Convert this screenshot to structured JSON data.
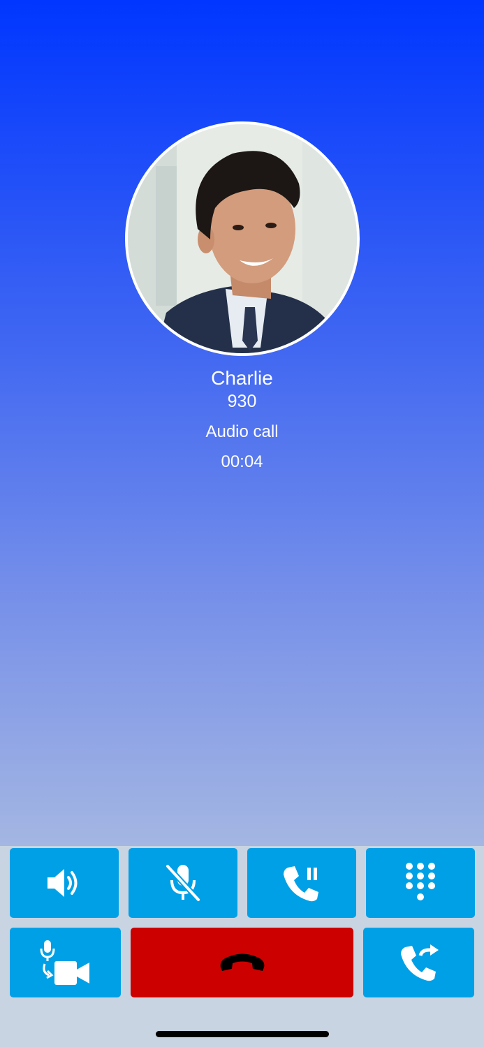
{
  "caller": {
    "name": "Charlie",
    "number": "930",
    "call_type": "Audio call",
    "duration": "00:04"
  },
  "colors": {
    "gradient_top": "#0036ff",
    "gradient_bottom": "#a4b6e2",
    "button": "#00a0e6",
    "end_call": "#cd0000",
    "controls_background": "#c9d4e2"
  },
  "controls": {
    "row1": [
      {
        "name": "speaker-button",
        "icon": "speaker-icon"
      },
      {
        "name": "mute-button",
        "icon": "mic-off-icon"
      },
      {
        "name": "hold-button",
        "icon": "phone-hold-icon"
      },
      {
        "name": "keypad-button",
        "icon": "dialpad-icon"
      }
    ],
    "row2": [
      {
        "name": "switch-to-video-button",
        "icon": "mic-to-video-icon"
      },
      {
        "name": "end-call-button",
        "icon": "hang-up-icon"
      },
      {
        "name": "transfer-button",
        "icon": "phone-transfer-icon"
      }
    ]
  }
}
